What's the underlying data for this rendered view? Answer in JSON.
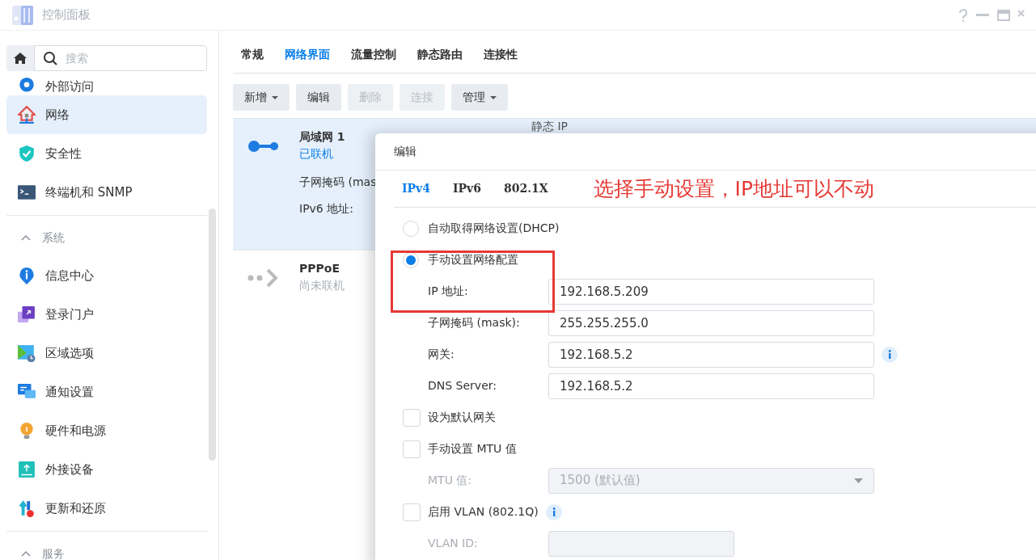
{
  "window": {
    "title": "控制面板"
  },
  "sidebar": {
    "search": {
      "placeholder": "搜索"
    },
    "items": [
      {
        "kind": "item",
        "label": "外部访问",
        "selected": false
      },
      {
        "kind": "item",
        "label": "网络",
        "selected": true
      },
      {
        "kind": "item",
        "label": "安全性",
        "selected": false
      },
      {
        "kind": "item",
        "label": "终端机和 SNMP",
        "selected": false
      },
      {
        "kind": "section",
        "label": "系统",
        "expanded": true
      },
      {
        "kind": "item",
        "label": "信息中心",
        "selected": false
      },
      {
        "kind": "item",
        "label": "登录门户",
        "selected": false
      },
      {
        "kind": "item",
        "label": "区域选项",
        "selected": false
      },
      {
        "kind": "item",
        "label": "通知设置",
        "selected": false
      },
      {
        "kind": "item",
        "label": "硬件和电源",
        "selected": false
      },
      {
        "kind": "item",
        "label": "外接设备",
        "selected": false
      },
      {
        "kind": "item",
        "label": "更新和还原",
        "selected": false
      },
      {
        "kind": "section",
        "label": "服务",
        "expanded": true
      }
    ]
  },
  "tabs": [
    {
      "label": "常规",
      "selected": false
    },
    {
      "label": "网络界面",
      "selected": true
    },
    {
      "label": "流量控制",
      "selected": false
    },
    {
      "label": "静态路由",
      "selected": false
    },
    {
      "label": "连接性",
      "selected": false
    }
  ],
  "toolbar": [
    {
      "label": "新增",
      "dropdown": true,
      "disabled": false
    },
    {
      "label": "编辑",
      "dropdown": false,
      "disabled": false
    },
    {
      "label": "删除",
      "dropdown": false,
      "disabled": true
    },
    {
      "label": "连接",
      "dropdown": false,
      "disabled": true
    },
    {
      "label": "管理",
      "dropdown": true,
      "disabled": false
    }
  ],
  "interfaces": [
    {
      "name": "局域网 1",
      "status": "已联机",
      "connected": true,
      "selected": true,
      "type": "静态 IP",
      "details": [
        "子网掩码 (mas",
        "IPv6 地址:"
      ]
    },
    {
      "name": "PPPoE",
      "status": "尚未联机",
      "connected": false,
      "selected": false
    }
  ],
  "dialog": {
    "title": "编辑",
    "tabs": [
      {
        "label": "IPv4",
        "selected": true
      },
      {
        "label": "IPv6",
        "selected": false
      },
      {
        "label": "802.1X",
        "selected": false
      }
    ],
    "annotation": "选择手动设置，IP地址可以不动",
    "rows": [
      {
        "kind": "radio",
        "label": "自动取得网络设置(DHCP)",
        "selected": false
      },
      {
        "kind": "radio",
        "label": "手动设置网络配置",
        "selected": true
      },
      {
        "kind": "field",
        "label": "IP 地址:",
        "value": "192.168.5.209",
        "disabled": false,
        "info": false
      },
      {
        "kind": "field",
        "label": "子网掩码 (mask):",
        "value": "255.255.255.0",
        "disabled": false,
        "info": false
      },
      {
        "kind": "field",
        "label": "网关:",
        "value": "192.168.5.2",
        "disabled": false,
        "info": true
      },
      {
        "kind": "field",
        "label": "DNS Server:",
        "value": "192.168.5.2",
        "disabled": false,
        "info": false
      },
      {
        "kind": "checkbox",
        "label": "设为默认网关",
        "checked": false,
        "info": false
      },
      {
        "kind": "checkbox",
        "label": "手动设置 MTU 值",
        "checked": false,
        "info": false
      },
      {
        "kind": "select",
        "label": "MTU 值:",
        "value": "1500 (默认值)",
        "disabled": true
      },
      {
        "kind": "checkbox",
        "label": "启用 VLAN (802.1Q)",
        "checked": false,
        "info": true
      },
      {
        "kind": "field",
        "label": "VLAN ID:",
        "disabled": true,
        "info": false
      }
    ]
  }
}
